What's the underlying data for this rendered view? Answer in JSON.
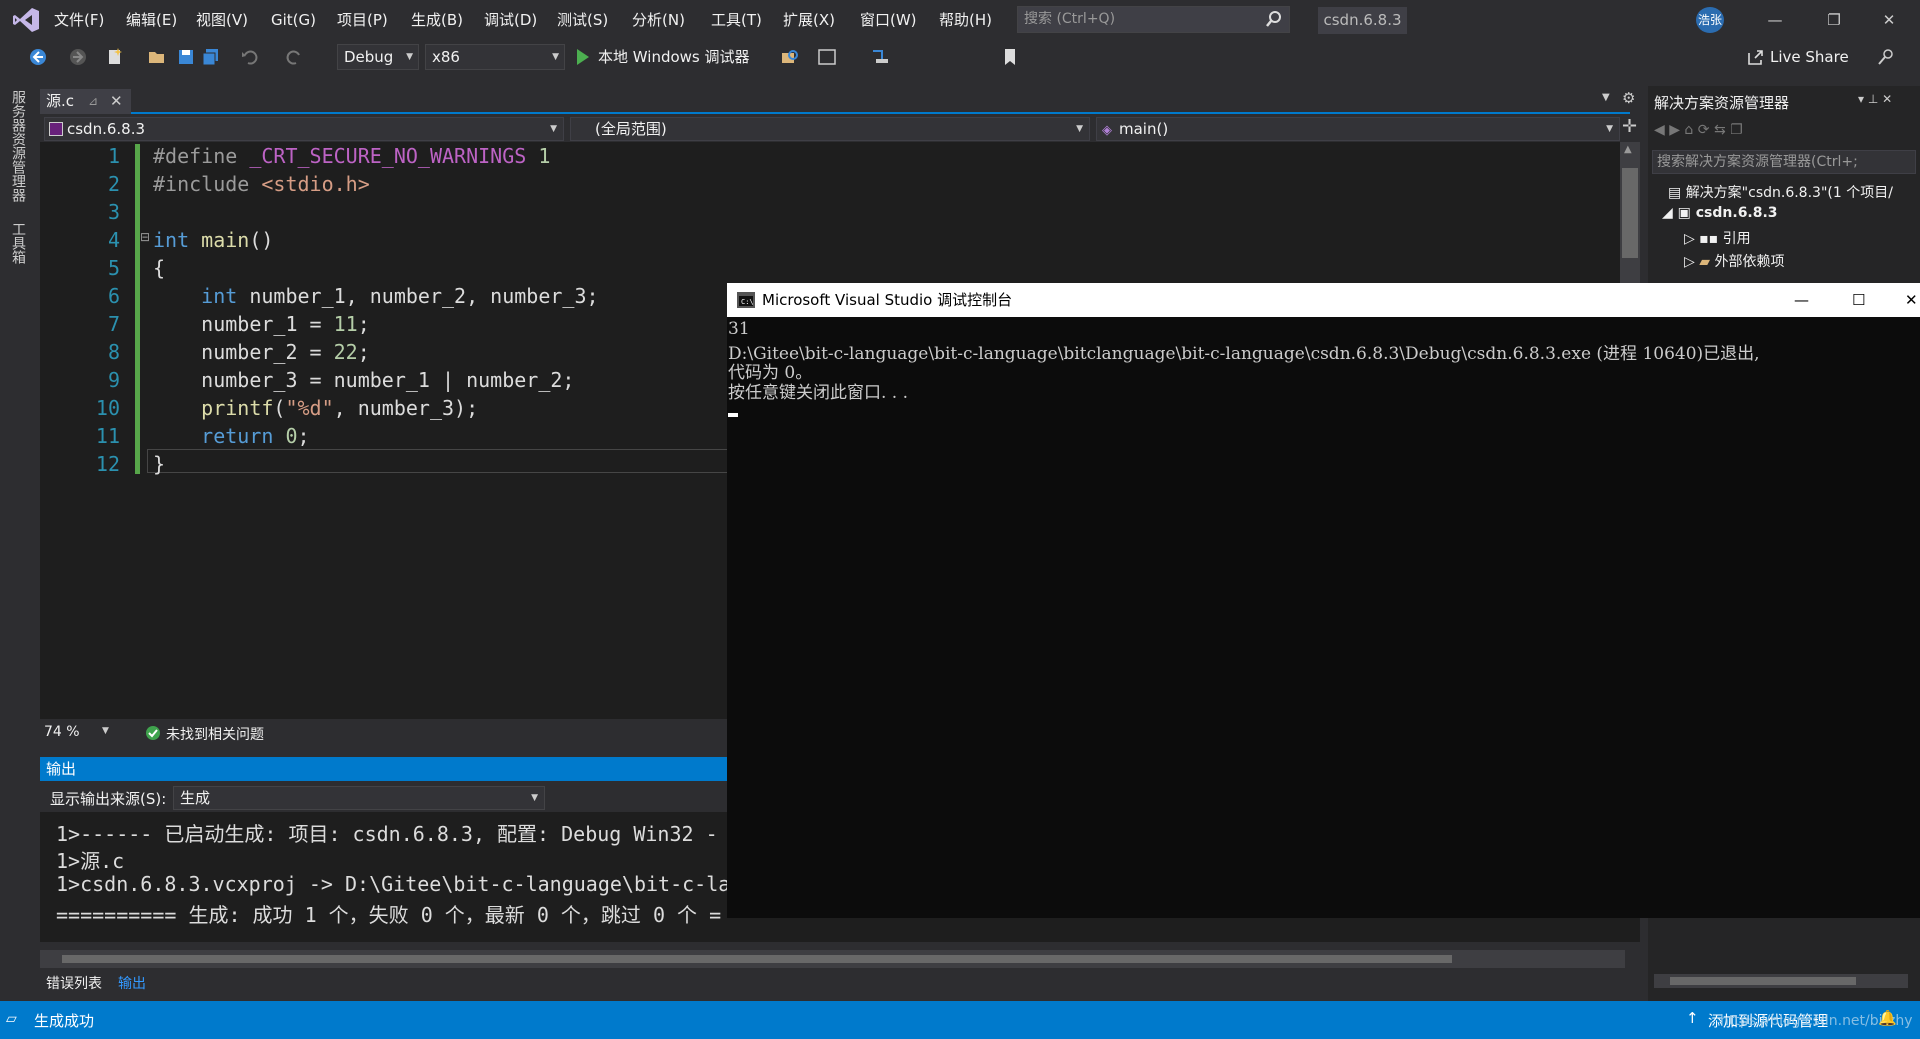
{
  "title_bar": {
    "menus": [
      "文件(F)",
      "编辑(E)",
      "视图(V)",
      "Git(G)",
      "项目(P)",
      "生成(B)",
      "调试(D)",
      "测试(S)",
      "分析(N)",
      "工具(T)",
      "扩展(X)",
      "窗口(W)",
      "帮助(H)"
    ],
    "search_placeholder": "搜索 (Ctrl+Q)",
    "solution_name": "csdn.6.8.3",
    "user_initials": "浩张",
    "window_buttons": [
      "—",
      "❐",
      "✕"
    ]
  },
  "toolbar": {
    "config": "Debug",
    "platform": "x86",
    "run_label": "本地 Windows 调试器",
    "live_share": "Live Share"
  },
  "left_strip": {
    "items": [
      "服务器资源管理器",
      "工具箱"
    ]
  },
  "document": {
    "tab_name": "源.c",
    "project_combo": "csdn.6.8.3",
    "scope_combo": "(全局范围)",
    "member_combo": "main()"
  },
  "code": {
    "line_numbers": [
      "1",
      "2",
      "3",
      "4",
      "5",
      "6",
      "7",
      "8",
      "9",
      "10",
      "11",
      "12"
    ]
  },
  "editor_status": {
    "zoom": "74 %",
    "issues": "未找到相关问题"
  },
  "output": {
    "header": "输出",
    "source_label": "显示输出来源(S):",
    "source_value": "生成",
    "lines": [
      "1>------ 已启动生成: 项目: csdn.6.8.3, 配置: Debug Win32 -",
      "1>源.c",
      "1>csdn.6.8.3.vcxproj -> D:\\Gitee\\bit-c-language\\bit-c-la",
      "========== 生成: 成功 1 个，失败 0 个，最新 0 个，跳过 0 个 ="
    ]
  },
  "bottom_tabs": [
    "错误列表",
    "输出"
  ],
  "status_bar": {
    "left": "生成成功",
    "right": "添加到源代码管理",
    "watermark": "https://blog.csdn.net/bitzhy"
  },
  "solution_explorer": {
    "title": "解决方案资源管理器",
    "search_placeholder": "搜索解决方案资源管理器(Ctrl+;",
    "items": [
      "解决方案\"csdn.6.8.3\"(1 个项目/",
      "csdn.6.8.3",
      "引用",
      "外部依赖项"
    ]
  },
  "console": {
    "title": "Microsoft Visual Studio 调试控制台",
    "lines": [
      "31",
      "D:\\Gitee\\bit-c-language\\bit-c-language\\bitclanguage\\bit-c-language\\csdn.6.8.3\\Debug\\csdn.6.8.3.exe (进程 10640)已退出,",
      "代码为 0。",
      "按任意键关闭此窗口. . ."
    ]
  },
  "colors": {
    "accent": "#007acc",
    "chrome": "#2d2d30",
    "editor": "#1e1e1e",
    "console_bg": "#0c0c0c"
  }
}
